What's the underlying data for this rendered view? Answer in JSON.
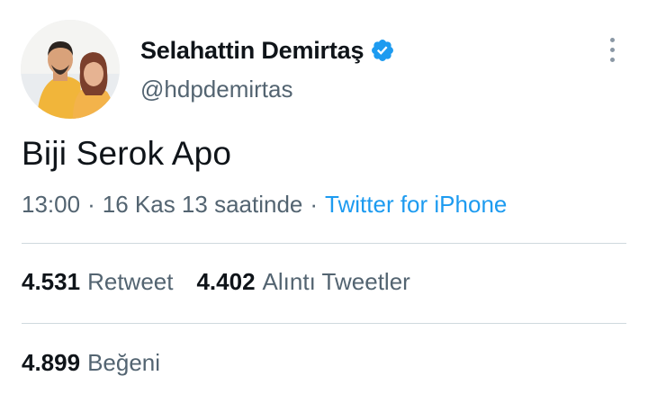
{
  "tweet": {
    "author": {
      "display_name": "Selahattin Demirtaş",
      "handle": "@hdpdemirtas",
      "verified": true,
      "avatar_icon": "profile-photo"
    },
    "text": "Biji Serok Apo",
    "meta": {
      "time": "13:00",
      "separator": "·",
      "date": "16 Kas 13 saatinde",
      "source": "Twitter for iPhone"
    },
    "stats": {
      "retweets": {
        "count": "4.531",
        "label": "Retweet"
      },
      "quotes": {
        "count": "4.402",
        "label": "Alıntı Tweetler"
      },
      "likes": {
        "count": "4.899",
        "label": "Beğeni"
      }
    },
    "more_icon": "ellipsis-vertical"
  },
  "colors": {
    "text_primary": "#0f1419",
    "text_secondary": "#536471",
    "link": "#1d9bf0",
    "verified_badge": "#1d9bf0",
    "divider": "#cfd9de"
  }
}
